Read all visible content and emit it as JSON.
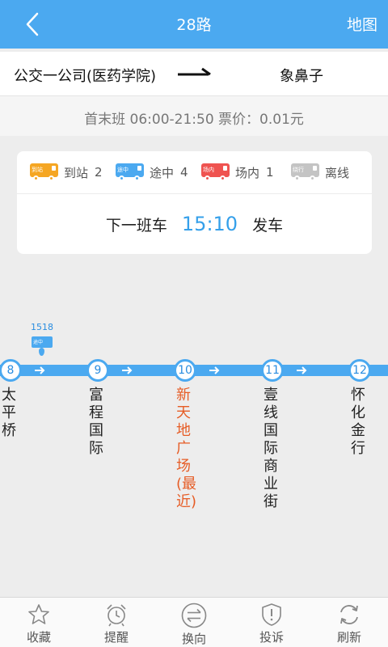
{
  "header": {
    "title": "28路",
    "map_label": "地图"
  },
  "route": {
    "from": "公交一公司(医药学院)",
    "to": "象鼻子"
  },
  "info": {
    "text": "首末班 06:00-21:50   票价：0.01元"
  },
  "legend": [
    {
      "icon_text": "到站",
      "label": "到站",
      "count": "2",
      "color": "#f5a623"
    },
    {
      "icon_text": "途中",
      "label": "途中",
      "count": "4",
      "color": "#4ba9f0"
    },
    {
      "icon_text": "场内",
      "label": "场内",
      "count": "1",
      "color": "#ef5350"
    },
    {
      "icon_text": "绕行",
      "label": "离线",
      "count": "",
      "color": "#c4c4c4"
    }
  ],
  "next_bus": {
    "prefix": "下一班车",
    "time": "15:10",
    "suffix": "发车"
  },
  "bus_marker": {
    "number": "1518",
    "icon_text": "途中"
  },
  "stations": [
    {
      "num": "8",
      "name": "太平桥"
    },
    {
      "num": "9",
      "name": "富程国际"
    },
    {
      "num": "10",
      "name": "新天地广场(最近)"
    },
    {
      "num": "11",
      "name": "壹线国际商业街"
    },
    {
      "num": "12",
      "name": "怀化金行"
    }
  ],
  "tabs": [
    {
      "label": "收藏",
      "icon": "star-icon"
    },
    {
      "label": "提醒",
      "icon": "alarm-clock-icon"
    },
    {
      "label": "换向",
      "icon": "swap-direction-icon"
    },
    {
      "label": "投诉",
      "icon": "complaint-shield-icon"
    },
    {
      "label": "刷新",
      "icon": "refresh-icon"
    }
  ],
  "colors": {
    "primary": "#4ba9f0",
    "nearest": "#e65c25",
    "arrived": "#f5a623",
    "depot": "#ef5350",
    "offline": "#c4c4c4"
  }
}
